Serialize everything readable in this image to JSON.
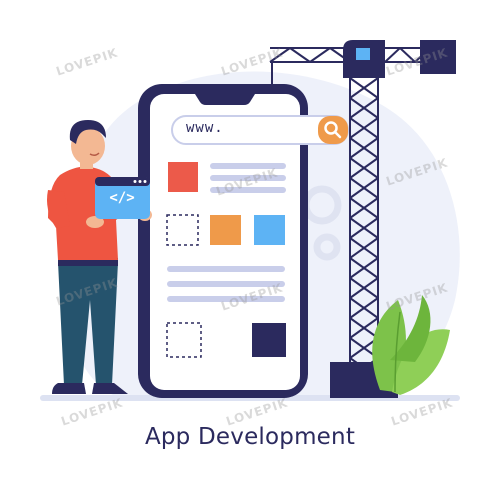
{
  "caption": "App Development",
  "search_bar": {
    "text": "www."
  },
  "code_window": {
    "text": "</>"
  },
  "watermark": "LOVEPIK",
  "colors": {
    "navy": "#2b2a5e",
    "orange": "#ef9a4a",
    "red": "#ec5a4a",
    "blue": "#5db3f4",
    "lavender": "#c9ceea",
    "bg_blob": "#eef1fa",
    "shirt": "#ee5541",
    "jeans": "#25536d",
    "leaf": "#7dc24a"
  },
  "icons": [
    "search-icon",
    "code-icon",
    "gear-icon",
    "crane-icon",
    "plant-icon"
  ]
}
